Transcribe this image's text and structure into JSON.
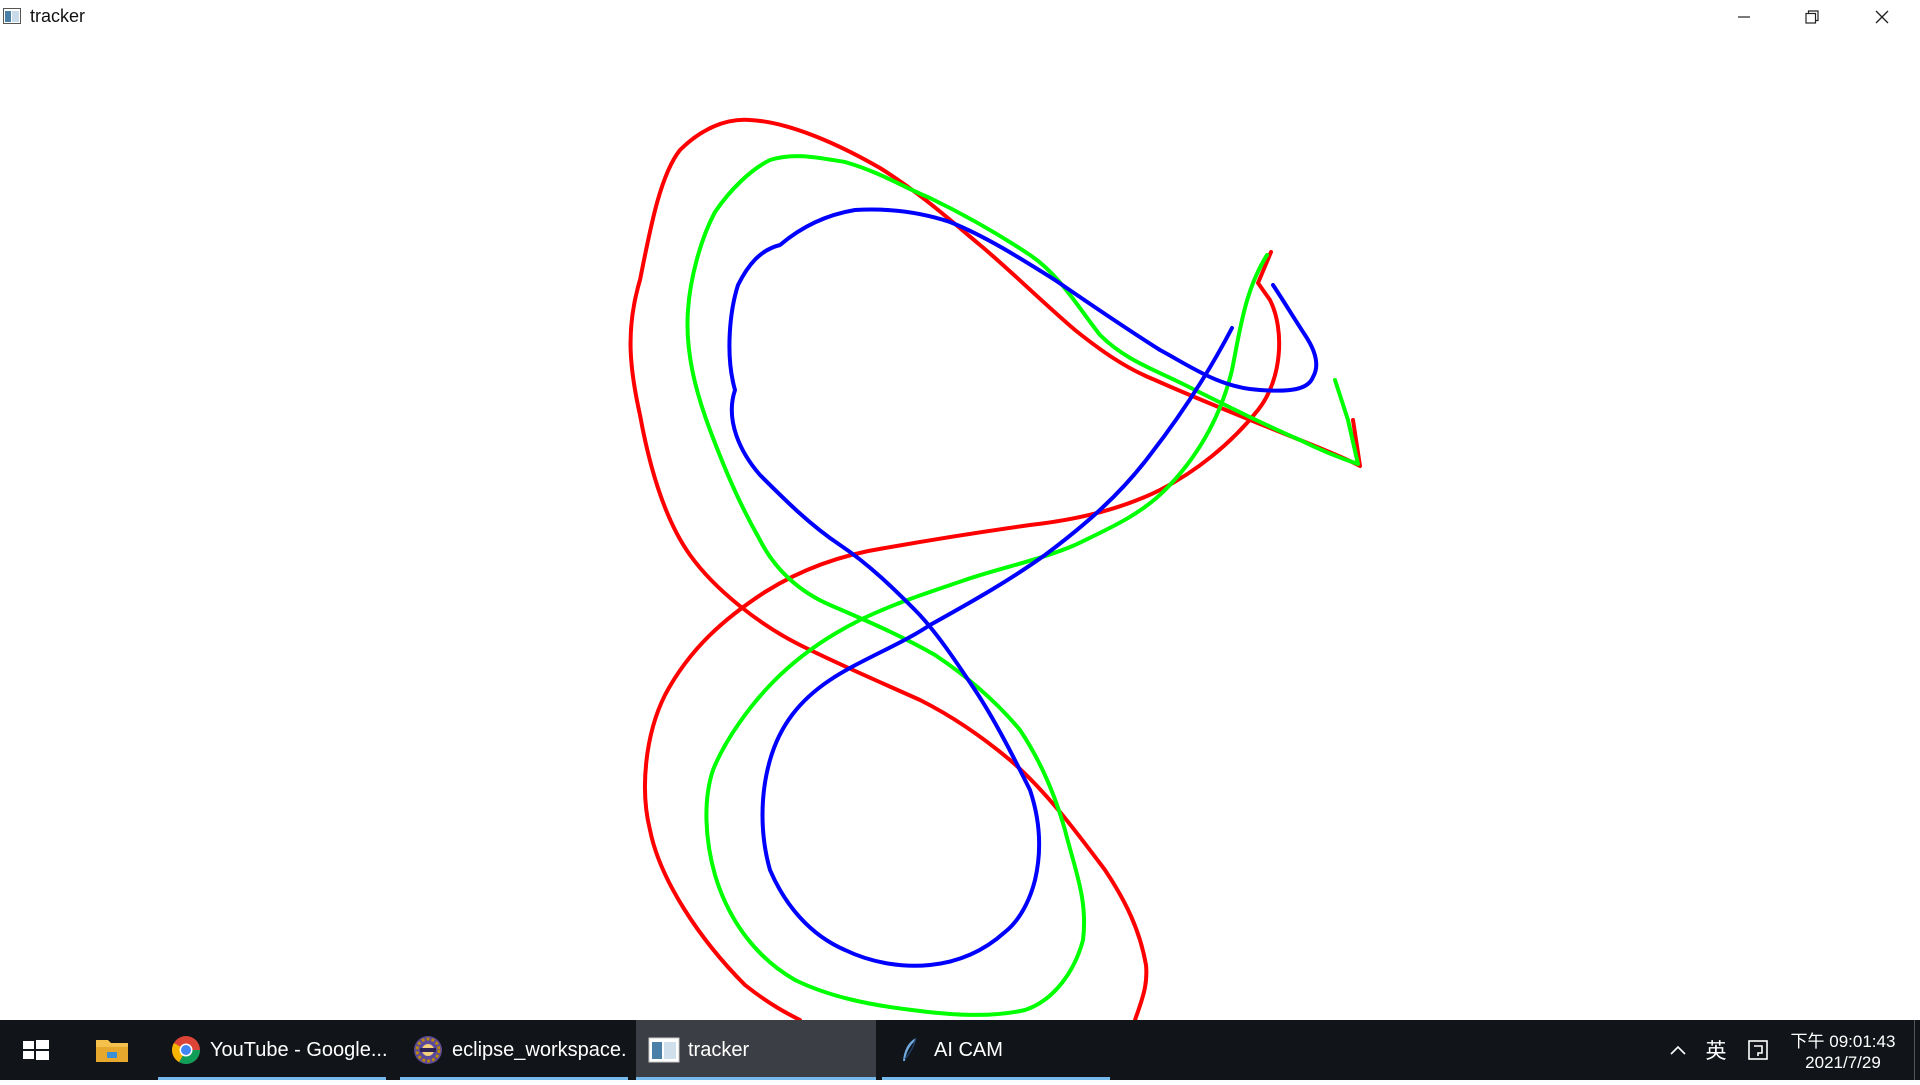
{
  "window": {
    "title": "tracker",
    "app_icon": "opencv-window-icon",
    "controls": [
      "minimize-icon",
      "restore-icon",
      "close-icon"
    ]
  },
  "canvas": {
    "background": "#ffffff",
    "trajectory_colors": {
      "red": "#ff0000",
      "green": "#00ff00",
      "blue": "#0000ff"
    }
  },
  "taskbar": {
    "background": "#111418",
    "start_icon": "windows-logo-icon",
    "pinned": [
      {
        "icon": "file-explorer-icon"
      }
    ],
    "tasks": [
      {
        "icon": "chrome-icon",
        "label": "YouTube - Google...",
        "active": false
      },
      {
        "icon": "eclipse-icon",
        "label": "eclipse_workspace...",
        "active": false
      },
      {
        "icon": "tracker-window-icon",
        "label": "tracker",
        "active": true
      },
      {
        "icon": "feather-icon",
        "label": "AI CAM",
        "active": false
      }
    ],
    "tray": {
      "chevron_icon": "chevron-up-icon",
      "ime_label": "英",
      "ime_mode_icon": "ime-mode-icon",
      "time": "下午 09:01:43",
      "date": "2021/7/29"
    },
    "accent": "#76b9ed"
  }
}
